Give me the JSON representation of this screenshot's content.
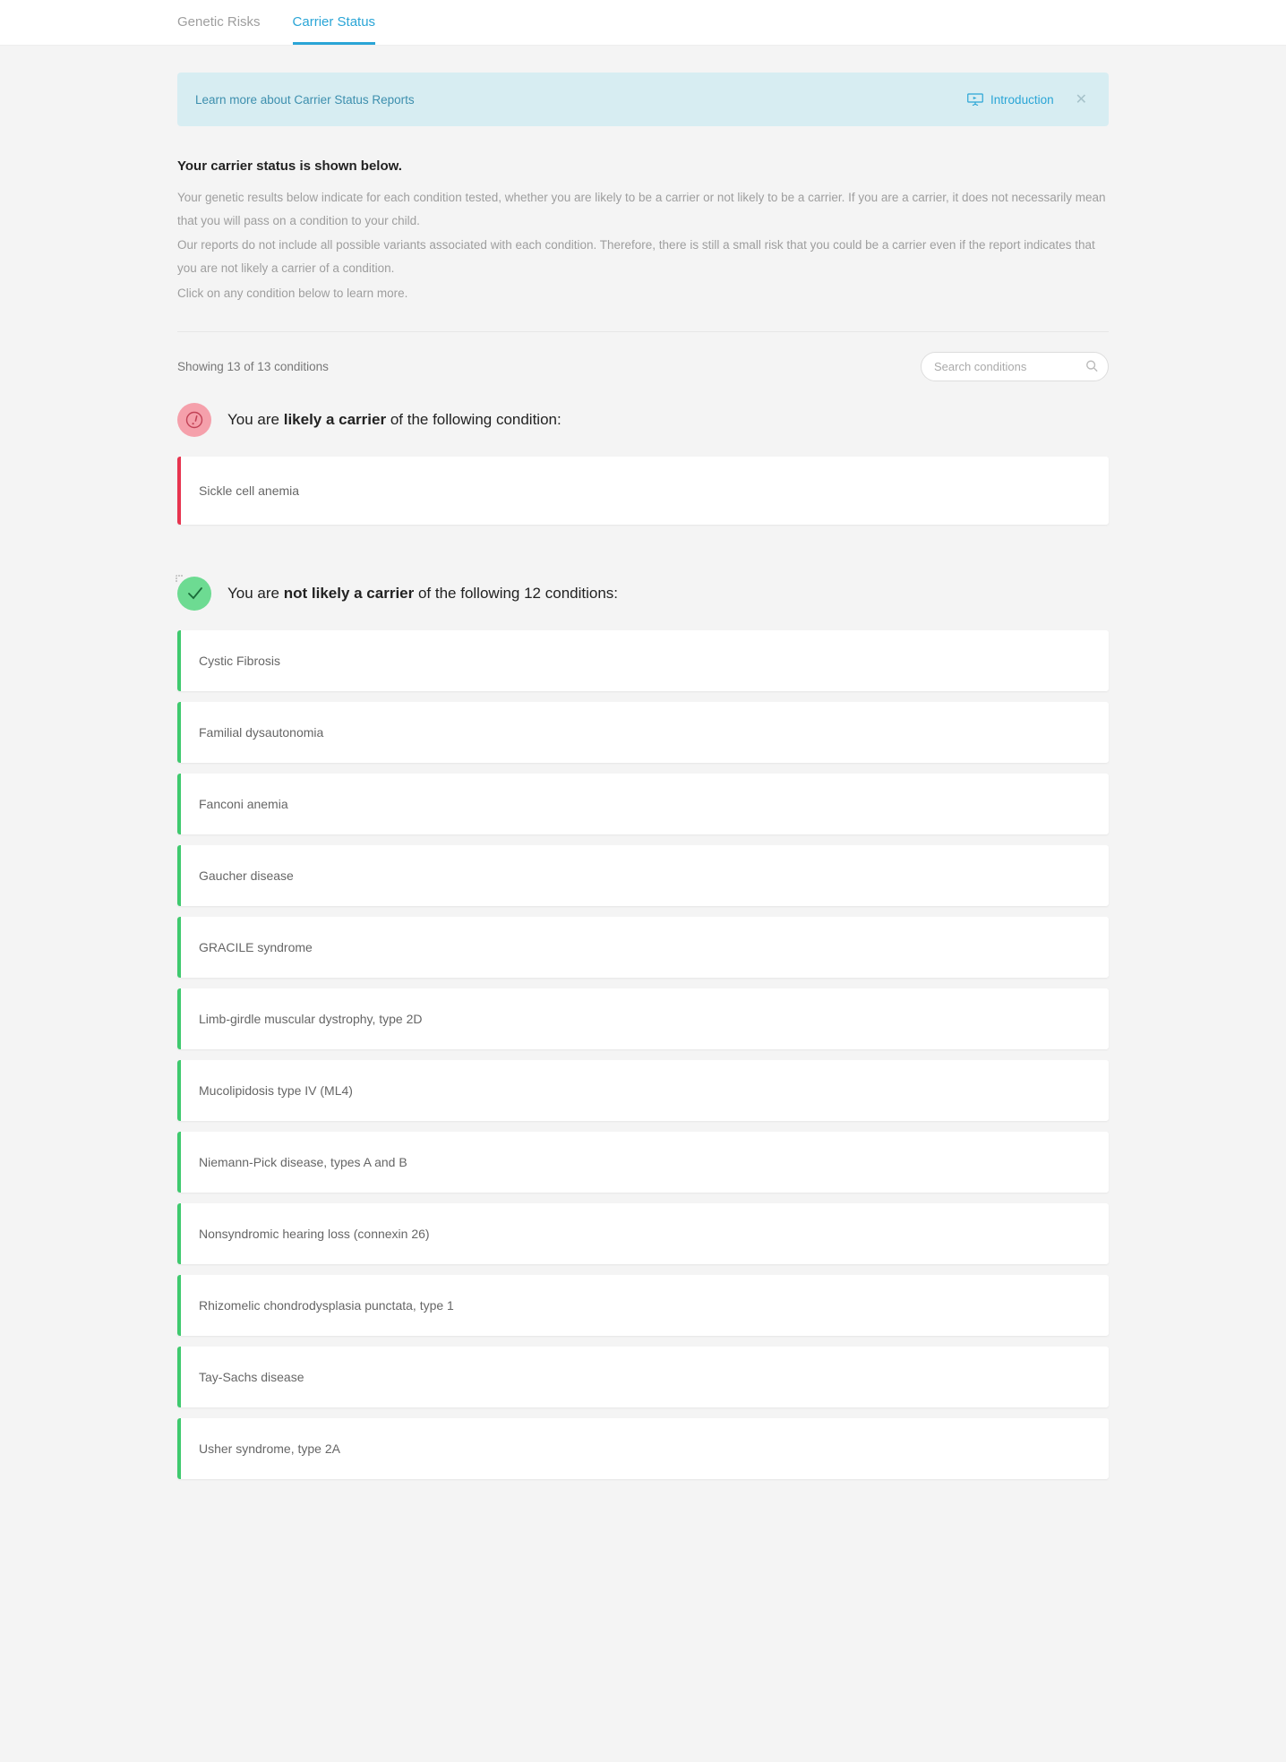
{
  "tabs": {
    "genetic_risks": "Genetic Risks",
    "carrier_status": "Carrier Status"
  },
  "banner": {
    "text": "Learn more about Carrier Status Reports",
    "intro": "Introduction"
  },
  "intro": {
    "headline": "Your carrier status is shown below.",
    "p1": "Your genetic results below indicate for each condition tested, whether you are likely to be a carrier or not likely to be a carrier. If you are a carrier, it does not necessarily mean that you will pass on a condition to your child.",
    "p2": "Our reports do not include all possible variants associated with each condition. Therefore, there is still a small risk that you could be a carrier even if the report indicates that you are not likely a carrier of a condition.",
    "p3": "Click on any condition below to learn more."
  },
  "toolbar": {
    "count": "Showing 13 of 13 conditions",
    "search_placeholder": "Search conditions"
  },
  "likely": {
    "prefix": "You are ",
    "bold": "likely a carrier",
    "suffix": " of the following condition:",
    "items": [
      "Sickle cell anemia"
    ]
  },
  "not_likely": {
    "prefix": "You are ",
    "bold": "not likely a carrier",
    "suffix": " of the following 12 conditions:",
    "items": [
      "Cystic Fibrosis",
      "Familial dysautonomia",
      "Fanconi anemia",
      "Gaucher disease",
      "GRACILE syndrome",
      "Limb-girdle muscular dystrophy, type 2D",
      "Mucolipidosis type IV (ML4)",
      "Niemann-Pick disease, types A and B",
      "Nonsyndromic hearing loss (connexin 26)",
      "Rhizomelic chondrodysplasia punctata, type 1",
      "Tay-Sachs disease",
      "Usher syndrome, type 2A"
    ]
  }
}
